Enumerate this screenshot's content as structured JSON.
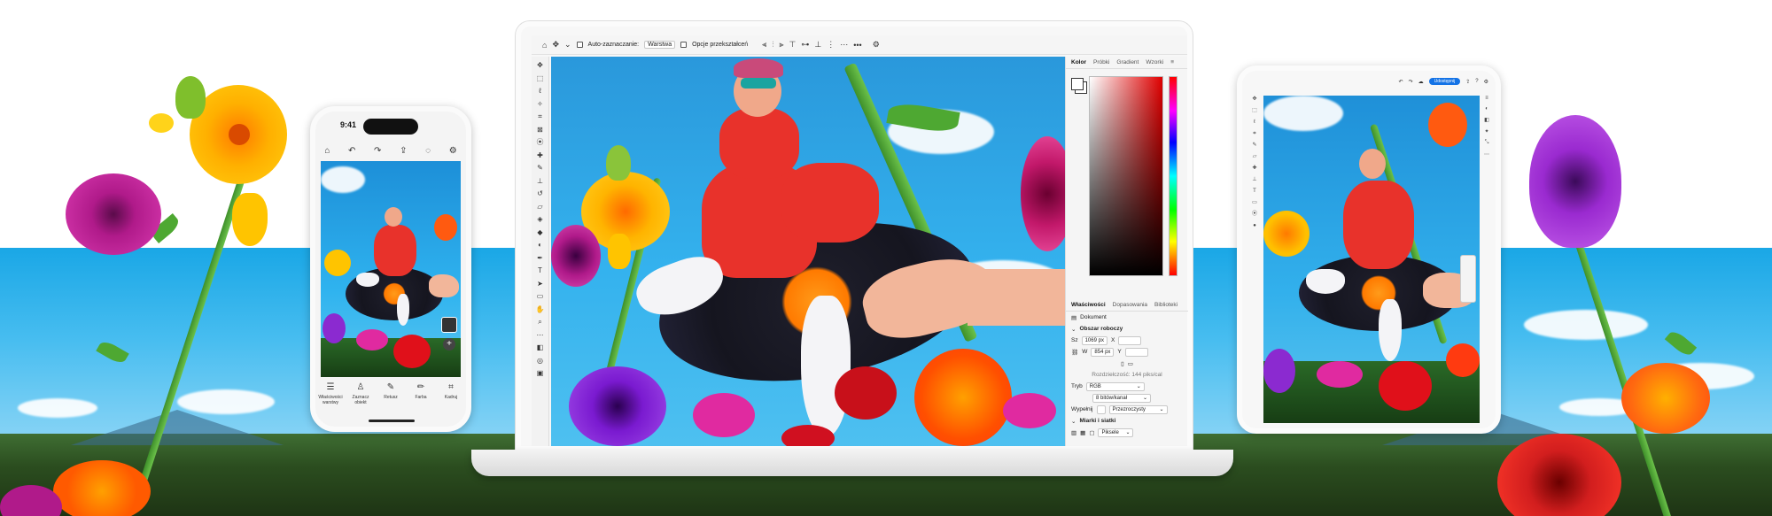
{
  "phone": {
    "time": "9:41",
    "bottom_items": [
      {
        "label": "Właściwości warstwy",
        "icon": "sliders-icon"
      },
      {
        "label": "Zaznacz obiekt",
        "icon": "select-subject-icon"
      },
      {
        "label": "Retusz",
        "icon": "retouch-icon"
      },
      {
        "label": "Farba",
        "icon": "brush-icon"
      },
      {
        "label": "Kadruj",
        "icon": "crop-icon"
      }
    ]
  },
  "desktop": {
    "options_bar": {
      "auto_select_label": "Auto-zaznaczanie:",
      "auto_select_value": "Warstwa",
      "transform_label": "Opcje przekształceń",
      "more": "•••"
    },
    "color_panel": {
      "tabs": [
        "Kolor",
        "Próbki",
        "Gradient",
        "Wzorki"
      ],
      "active_tab": "Kolor"
    },
    "properties_panel": {
      "tabs": [
        "Właściwości",
        "Dopasowania",
        "Biblioteki"
      ],
      "active_tab": "Właściwości",
      "document_label": "Dokument",
      "canvas_section": "Obszar roboczy",
      "width_label": "Sz",
      "width_value": "1069 px",
      "height_label": "W",
      "height_value": "854 px",
      "x_label": "X",
      "y_label": "Y",
      "resolution": "Rozdzielczość: 144 piks/cal",
      "mode_label": "Tryb",
      "mode_value": "RGB",
      "depth_value": "8 bitów/kanał",
      "fill_label": "Wypełnij",
      "fill_value": "Przezroczysty",
      "rulers_section": "Miarki i siatki",
      "units_value": "Piksele"
    }
  },
  "tablet": {
    "share_button": "Udostępnij"
  }
}
